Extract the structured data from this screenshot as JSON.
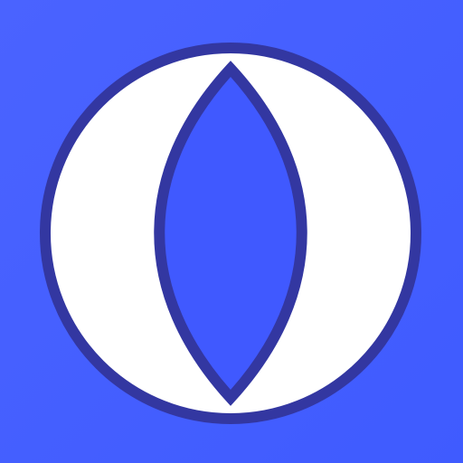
{
  "icon": {
    "name": "eye-lens-icon",
    "colors": {
      "background_start": "#4A63FF",
      "background_end": "#3F5BFF",
      "ring_fill": "#FFFFFF",
      "outline": "#3337A1",
      "lens_fill": "#4059FF"
    }
  }
}
